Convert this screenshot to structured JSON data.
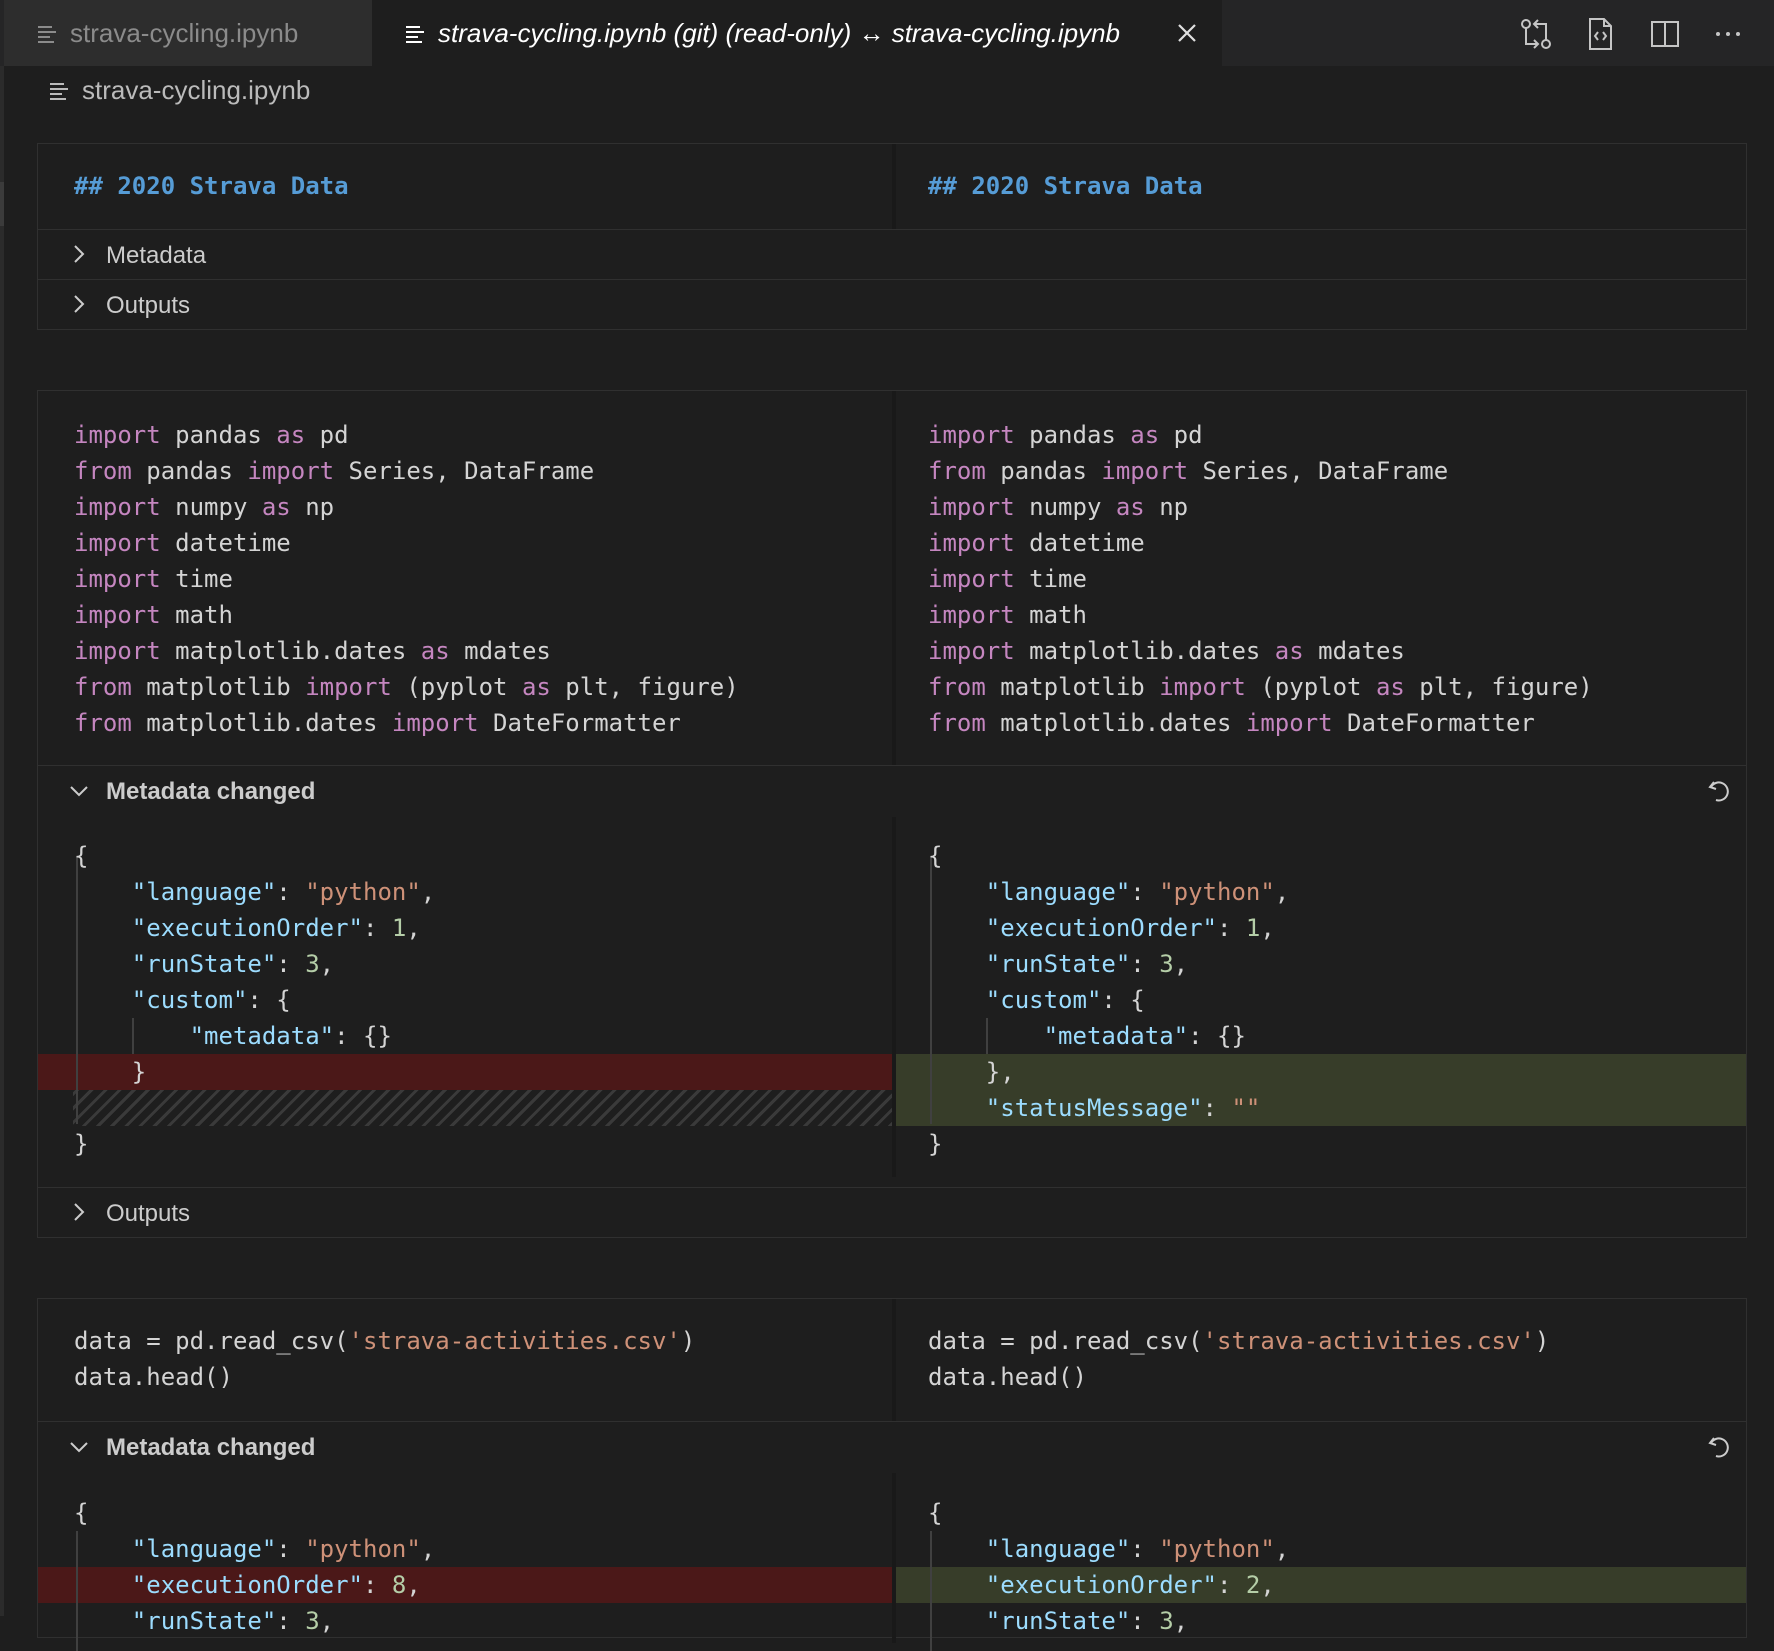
{
  "tabs": [
    {
      "label": "strava-cycling.ipynb"
    },
    {
      "label": "strava-cycling.ipynb (git) (read-only) ↔ strava-cycling.ipynb"
    }
  ],
  "breadcrumb": "strava-cycling.ipynb",
  "cell1": {
    "markdown": "## 2020 Strava Data",
    "rows": [
      "Metadata",
      "Outputs"
    ]
  },
  "cell2": {
    "code": [
      [
        [
          "kw",
          "import"
        ],
        [
          "t",
          " pandas "
        ],
        [
          "kw",
          "as"
        ],
        [
          "t",
          " pd"
        ]
      ],
      [
        [
          "kw",
          "from"
        ],
        [
          "t",
          " pandas "
        ],
        [
          "kw",
          "import"
        ],
        [
          "t",
          " Series, DataFrame"
        ]
      ],
      [
        [
          "kw",
          "import"
        ],
        [
          "t",
          " numpy "
        ],
        [
          "kw",
          "as"
        ],
        [
          "t",
          " np"
        ]
      ],
      [
        [
          "kw",
          "import"
        ],
        [
          "t",
          " datetime"
        ]
      ],
      [
        [
          "kw",
          "import"
        ],
        [
          "t",
          " time"
        ]
      ],
      [
        [
          "kw",
          "import"
        ],
        [
          "t",
          " math"
        ]
      ],
      [
        [
          "kw",
          "import"
        ],
        [
          "t",
          " matplotlib.dates "
        ],
        [
          "kw",
          "as"
        ],
        [
          "t",
          " mdates"
        ]
      ],
      [
        [
          "kw",
          "from"
        ],
        [
          "t",
          " matplotlib "
        ],
        [
          "kw",
          "import"
        ],
        [
          "t",
          " (pyplot "
        ],
        [
          "kw",
          "as"
        ],
        [
          "t",
          " plt, figure)"
        ]
      ],
      [
        [
          "kw",
          "from"
        ],
        [
          "t",
          " matplotlib.dates "
        ],
        [
          "kw",
          "import"
        ],
        [
          "t",
          " DateFormatter"
        ]
      ]
    ],
    "metadata_label": "Metadata changed",
    "outputs_label": "Outputs",
    "meta_left": [
      [
        [
          "t",
          "{"
        ]
      ],
      [
        [
          "t",
          "    "
        ],
        [
          "key",
          "\"language\""
        ],
        [
          "t",
          ": "
        ],
        [
          "str",
          "\"python\""
        ],
        [
          "t",
          ","
        ]
      ],
      [
        [
          "t",
          "    "
        ],
        [
          "key",
          "\"executionOrder\""
        ],
        [
          "t",
          ": "
        ],
        [
          "num",
          "1"
        ],
        [
          "t",
          ","
        ]
      ],
      [
        [
          "t",
          "    "
        ],
        [
          "key",
          "\"runState\""
        ],
        [
          "t",
          ": "
        ],
        [
          "num",
          "3"
        ],
        [
          "t",
          ","
        ]
      ],
      [
        [
          "t",
          "    "
        ],
        [
          "key",
          "\"custom\""
        ],
        [
          "t",
          ": {"
        ]
      ],
      [
        [
          "t",
          "        "
        ],
        [
          "key",
          "\"metadata\""
        ],
        [
          "t",
          ": {}"
        ]
      ],
      [
        [
          "t",
          "    }"
        ]
      ],
      [
        [
          "t",
          ""
        ]
      ],
      [
        [
          "t",
          "}"
        ]
      ]
    ],
    "meta_right": [
      [
        [
          "t",
          "{"
        ]
      ],
      [
        [
          "t",
          "    "
        ],
        [
          "key",
          "\"language\""
        ],
        [
          "t",
          ": "
        ],
        [
          "str",
          "\"python\""
        ],
        [
          "t",
          ","
        ]
      ],
      [
        [
          "t",
          "    "
        ],
        [
          "key",
          "\"executionOrder\""
        ],
        [
          "t",
          ": "
        ],
        [
          "num",
          "1"
        ],
        [
          "t",
          ","
        ]
      ],
      [
        [
          "t",
          "    "
        ],
        [
          "key",
          "\"runState\""
        ],
        [
          "t",
          ": "
        ],
        [
          "num",
          "3"
        ],
        [
          "t",
          ","
        ]
      ],
      [
        [
          "t",
          "    "
        ],
        [
          "key",
          "\"custom\""
        ],
        [
          "t",
          ": {"
        ]
      ],
      [
        [
          "t",
          "        "
        ],
        [
          "key",
          "\"metadata\""
        ],
        [
          "t",
          ": {}"
        ]
      ],
      [
        [
          "t",
          "    },"
        ]
      ],
      [
        [
          "t",
          "    "
        ],
        [
          "key",
          "\"statusMessage\""
        ],
        [
          "t",
          ": "
        ],
        [
          "str",
          "\"\""
        ]
      ],
      [
        [
          "t",
          "}"
        ]
      ]
    ]
  },
  "cell3": {
    "code": [
      [
        [
          "t",
          "data = pd.read_csv("
        ],
        [
          "str",
          "'strava-activities.csv'"
        ],
        [
          "t",
          ")"
        ]
      ],
      [
        [
          "t",
          "data.head()"
        ]
      ]
    ],
    "metadata_label": "Metadata changed",
    "meta_left": [
      [
        [
          "t",
          "{"
        ]
      ],
      [
        [
          "t",
          "    "
        ],
        [
          "key",
          "\"language\""
        ],
        [
          "t",
          ": "
        ],
        [
          "str",
          "\"python\""
        ],
        [
          "t",
          ","
        ]
      ],
      [
        [
          "t",
          "    "
        ],
        [
          "key",
          "\"executionOrder\""
        ],
        [
          "t",
          ": "
        ],
        [
          "num",
          "8"
        ],
        [
          "t",
          ","
        ]
      ],
      [
        [
          "t",
          "    "
        ],
        [
          "key",
          "\"runState\""
        ],
        [
          "t",
          ": "
        ],
        [
          "num",
          "3"
        ],
        [
          "t",
          ","
        ]
      ]
    ],
    "meta_right": [
      [
        [
          "t",
          "{"
        ]
      ],
      [
        [
          "t",
          "    "
        ],
        [
          "key",
          "\"language\""
        ],
        [
          "t",
          ": "
        ],
        [
          "str",
          "\"python\""
        ],
        [
          "t",
          ","
        ]
      ],
      [
        [
          "t",
          "    "
        ],
        [
          "key",
          "\"executionOrder\""
        ],
        [
          "t",
          ": "
        ],
        [
          "num",
          "2"
        ],
        [
          "t",
          ","
        ]
      ],
      [
        [
          "t",
          "    "
        ],
        [
          "key",
          "\"runState\""
        ],
        [
          "t",
          ": "
        ],
        [
          "num",
          "3"
        ],
        [
          "t",
          ","
        ]
      ]
    ]
  }
}
